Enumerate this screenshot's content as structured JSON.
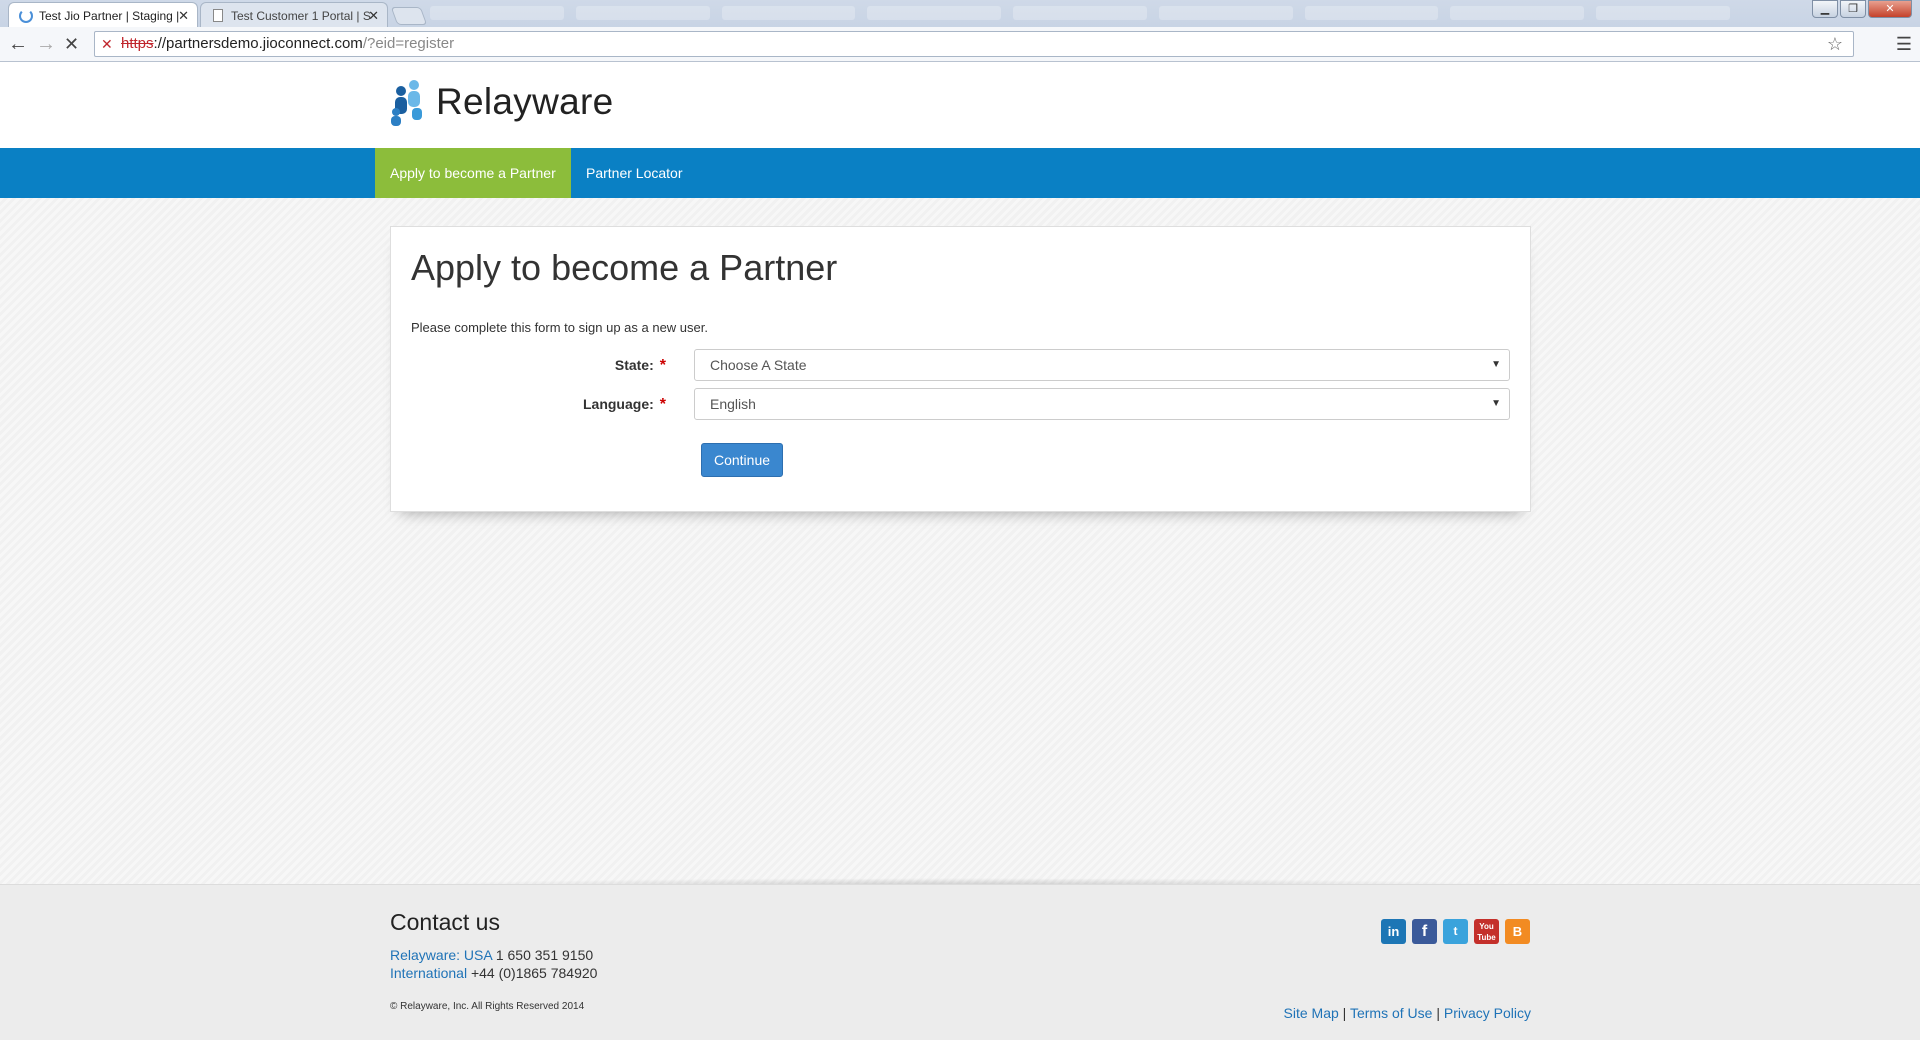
{
  "browser": {
    "tabs": [
      {
        "title": "Test Jio Partner | Staging |",
        "active": true
      },
      {
        "title": "Test Customer 1 Portal | S",
        "active": false
      }
    ],
    "url_scheme": "https",
    "url_host": "://partnersdemo.jioconnect.com",
    "url_path": "/?eid=register"
  },
  "header": {
    "logo_text": "Relayware"
  },
  "nav": {
    "items": [
      {
        "label": "Apply to become a Partner",
        "active": true
      },
      {
        "label": "Partner Locator",
        "active": false
      }
    ]
  },
  "form": {
    "title": "Apply to become a Partner",
    "intro": "Please complete this form to sign up as a new user.",
    "state_label": "State:",
    "state_value": "Choose A State",
    "language_label": "Language:",
    "language_value": "English",
    "required_mark": "*",
    "continue_label": "Continue"
  },
  "footer": {
    "contact_title": "Contact us",
    "usa_link": "Relayware: USA",
    "usa_phone": " 1 650 351 9150",
    "intl_link": "International",
    "intl_phone": " +44 (0)1865 784920",
    "copyright": "© Relayware, Inc. All Rights Reserved 2014",
    "links": [
      "Site Map",
      "Terms of Use",
      "Privacy Policy"
    ],
    "separator": " | ",
    "social": [
      {
        "name": "linkedin-icon",
        "glyph": "in"
      },
      {
        "name": "facebook-icon",
        "glyph": "f"
      },
      {
        "name": "twitter-icon",
        "glyph": "t"
      },
      {
        "name": "youtube-icon",
        "glyph": "You Tube"
      },
      {
        "name": "blogger-icon",
        "glyph": "B"
      }
    ]
  },
  "colors": {
    "nav_bg": "#0a80c4",
    "nav_active": "#8cbd3b",
    "button": "#3a87cf",
    "link": "#1f73b7",
    "required": "#cc0000"
  }
}
